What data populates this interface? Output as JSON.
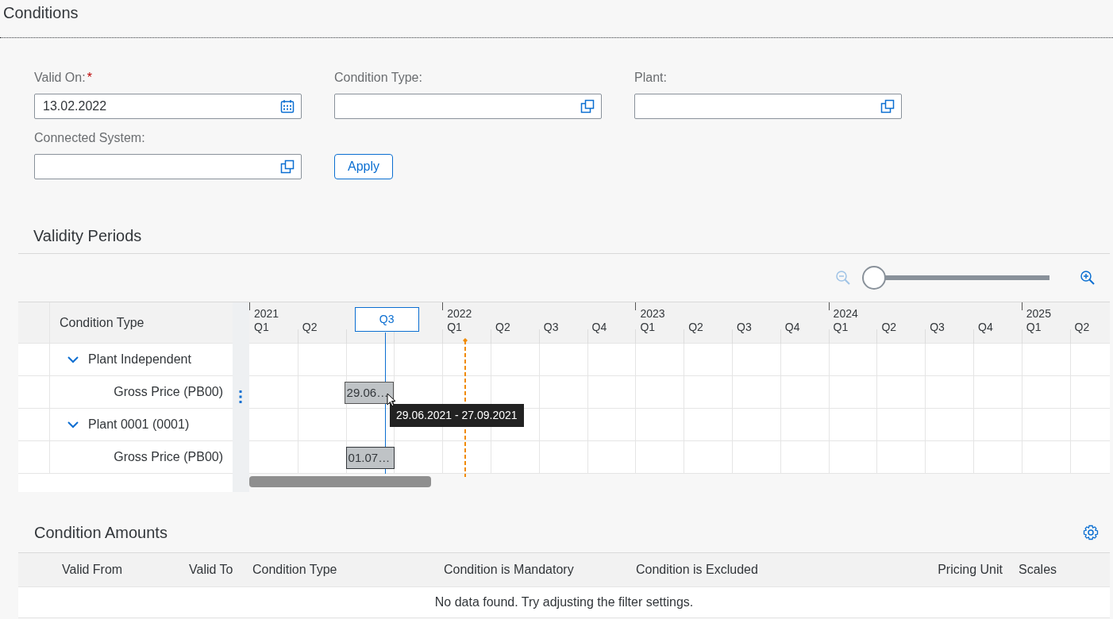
{
  "page": {
    "title": "Conditions"
  },
  "required_mark": "*",
  "filters": [
    {
      "label": "Valid On:",
      "required": true,
      "value": "13.02.2022",
      "kind": "date"
    },
    {
      "label": "Condition Type:",
      "required": false,
      "kind": "value-help"
    },
    {
      "label": "Plant:",
      "required": false,
      "kind": "value-help"
    },
    {
      "label": "Connected System:",
      "required": false,
      "kind": "value-help"
    }
  ],
  "apply_button": "Apply",
  "validity_periods": {
    "title": "Validity Periods",
    "zoom": {
      "level": 0,
      "zoom_out_disabled": true
    },
    "column_header": "Condition Type",
    "quarters": [
      {
        "year": "2021",
        "label": "Q1",
        "highlighted": false
      },
      {
        "label": "Q2",
        "highlighted": false
      },
      {
        "label": "Q3",
        "highlighted": true
      },
      {
        "highlighted": false
      },
      {
        "year": "2022",
        "label": "Q1",
        "highlighted": false
      },
      {
        "label": "Q2",
        "highlighted": false
      },
      {
        "label": "Q3",
        "highlighted": false
      },
      {
        "label": "Q4",
        "highlighted": false
      },
      {
        "year": "2023",
        "label": "Q1",
        "highlighted": false
      },
      {
        "label": "Q2",
        "highlighted": false
      },
      {
        "label": "Q3",
        "highlighted": false
      },
      {
        "label": "Q4",
        "highlighted": false
      },
      {
        "year": "2024",
        "label": "Q1",
        "highlighted": false
      },
      {
        "label": "Q2",
        "highlighted": false
      },
      {
        "label": "Q3",
        "highlighted": false
      },
      {
        "label": "Q4",
        "highlighted": false
      },
      {
        "year": "2025",
        "label": "Q1",
        "highlighted": false
      },
      {
        "label": "Q2",
        "highlighted": false
      }
    ],
    "rows": [
      {
        "label": "Plant Independent",
        "expanded": true,
        "children": [
          {
            "label": "Gross Price (PB00)",
            "bar": "29.06…",
            "hovered": true
          }
        ]
      },
      {
        "label": "Plant 0001 (0001)",
        "expanded": true,
        "children": [
          {
            "label": "Gross Price (PB00)",
            "bar": "01.07…",
            "hovered": false
          }
        ]
      }
    ],
    "tooltip": "29.06.2021 - 27.09.2021"
  },
  "condition_amounts": {
    "title": "Condition Amounts",
    "columns": [
      "Valid From",
      "Valid To",
      "Condition Type",
      "Condition is Mandatory",
      "Condition is Excluded",
      "Pricing Unit",
      "Scales"
    ],
    "empty_text": "No data found. Try adjusting the filter settings."
  }
}
